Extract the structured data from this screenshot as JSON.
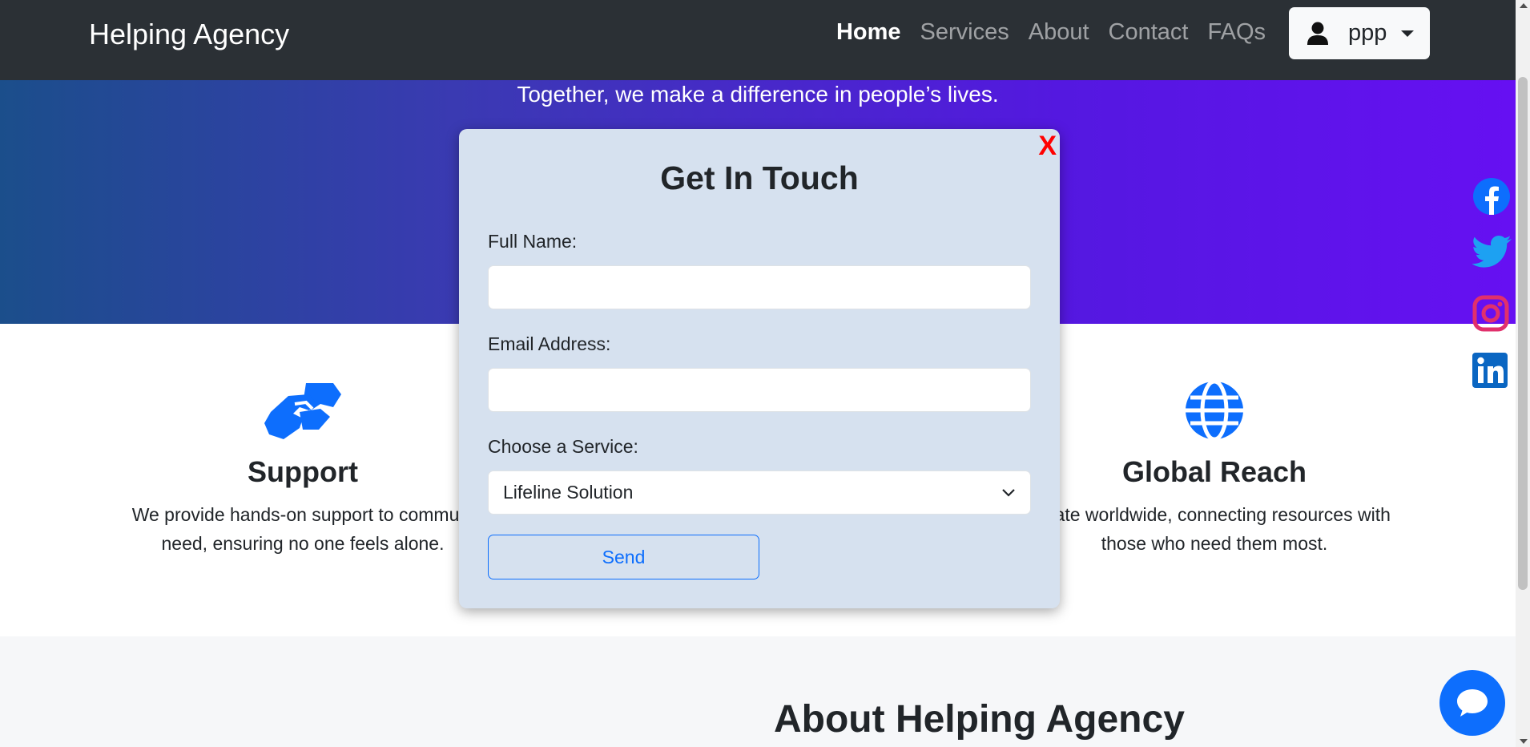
{
  "navbar": {
    "brand": "Helping Agency",
    "links": [
      {
        "label": "Home",
        "active": true
      },
      {
        "label": "Services",
        "active": false
      },
      {
        "label": "About",
        "active": false
      },
      {
        "label": "Contact",
        "active": false
      },
      {
        "label": "FAQs",
        "active": false
      }
    ],
    "user": {
      "name": "ppp",
      "icon": "person-icon"
    }
  },
  "hero": {
    "tagline": "Together, we make a difference in people’s lives."
  },
  "features": [
    {
      "icon": "handshake-icon",
      "title": "Support",
      "line1": "We provide hands-on support to communi",
      "line2": "need, ensuring no one feels alone."
    },
    {
      "icon": "globe-icon",
      "title": "Global Reach",
      "line1": "erate worldwide, connecting resources with",
      "line2": "those who need them most."
    }
  ],
  "about": {
    "title": "About Helping Agency"
  },
  "social": [
    "facebook-icon",
    "twitter-icon",
    "instagram-icon",
    "linkedin-icon"
  ],
  "modal": {
    "close_label": "X",
    "title": "Get In Touch",
    "fields": {
      "full_name": {
        "label": "Full Name:",
        "value": ""
      },
      "email": {
        "label": "Email Address:",
        "value": ""
      },
      "service": {
        "label": "Choose a Service:",
        "selected": "Lifeline Solution"
      }
    },
    "send_label": "Send"
  },
  "colors": {
    "navbar": "#2b3035",
    "accent": "#0d6efd",
    "modal_bg": "#d6e1ef",
    "close": "#ff0000"
  }
}
